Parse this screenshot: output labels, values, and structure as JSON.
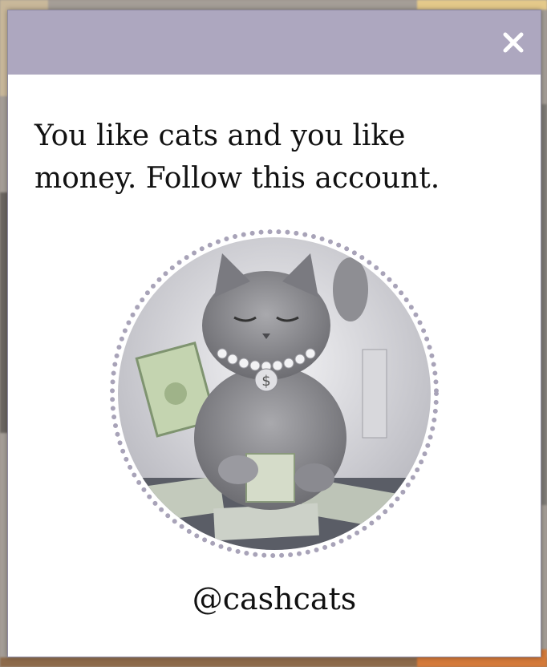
{
  "modal": {
    "message": "You like cats and you like money. Follow this account.",
    "handle": "@cashcats",
    "close_icon": "close-icon",
    "avatar_icon": "cat-with-money-avatar"
  },
  "colors": {
    "header": "#ada7bf",
    "ring_dots": "#a8a3b8",
    "text": "#111111",
    "close": "#ffffff"
  }
}
